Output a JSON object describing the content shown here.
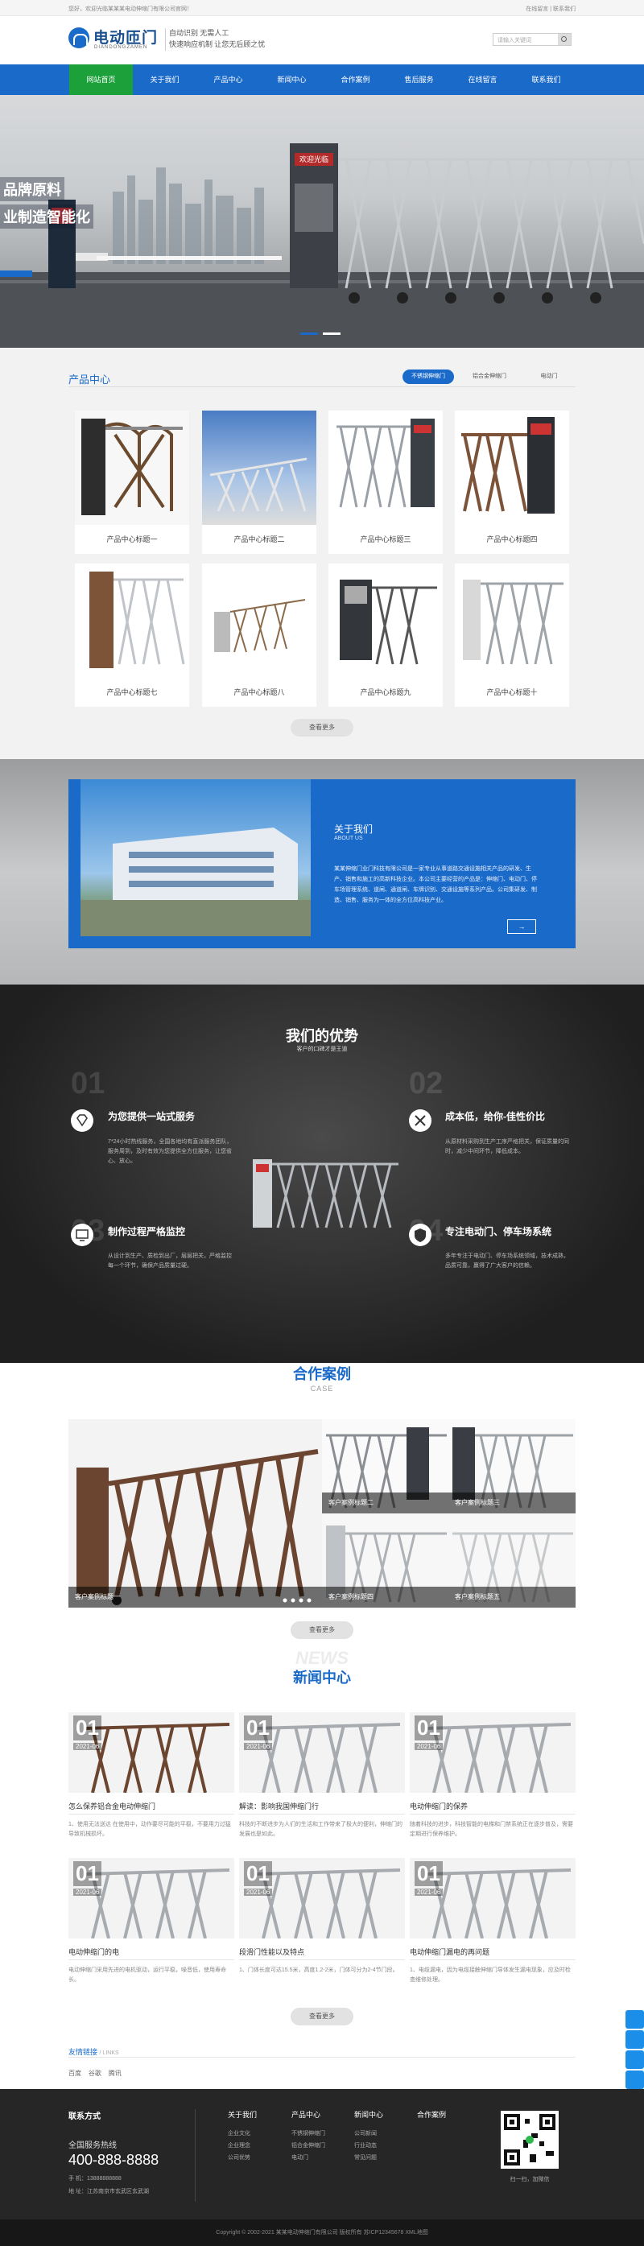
{
  "topbar": {
    "left": "您好，欢迎光临某某某电动伸缩门有限公司官网！",
    "right": "在线留言 | 联系我们"
  },
  "header": {
    "logo_text": "电动匝门",
    "logo_sub": "DIANDONGZAMEN",
    "slogan1": "自动识别 无需人工",
    "slogan2": "快速响应机制 让您无后顾之忧",
    "search_placeholder": "请输入关键词"
  },
  "nav": [
    "网站首页",
    "关于我们",
    "产品中心",
    "新闻中心",
    "合作案例",
    "售后服务",
    "在线留言",
    "联系我们"
  ],
  "banner": {
    "line1": "品牌原料",
    "line2": "业制造智能化",
    "sign": "欢迎光临"
  },
  "products": {
    "title": "产品中心",
    "tabs": [
      "不锈钢伸缩门",
      "铝合金伸缩门",
      "电动门"
    ],
    "items": [
      "产品中心标题一",
      "产品中心标题二",
      "产品中心标题三",
      "产品中心标题四",
      "产品中心标题七",
      "产品中心标题八",
      "产品中心标题九",
      "产品中心标题十"
    ],
    "more": "查看更多"
  },
  "about": {
    "title": "关于我们",
    "sub": "ABOUT US",
    "text": "某某伸缩门业门科技有限公司是一家专业从事道路交通设施相关产品的研发、生产、销售和施工的高新科技企业。本公司主要经营的产品是：伸缩门、电动门、停车场管理系统、道闸、通道闸、车牌识别、交通设施等系列产品。公司集研发、制造、销售、服务为一体的全方位高科技产业。",
    "arrow": "→"
  },
  "advantages": {
    "title": "我们的优势",
    "sub": "客户的口碑才是王道",
    "items": [
      {
        "num": "01",
        "title": "为您提供一站式服务",
        "text": "7*24小时热线服务，全国各地均有直派服务团队，服务周到，及时有效为您提供全方位服务，让您省心、放心。"
      },
      {
        "num": "02",
        "title": "成本低，给你-佳性价比",
        "text": "从原材料采购到生产工序严格把关，保证质量的同时，减少中间环节，降低成本。"
      },
      {
        "num": "03",
        "title": "制作过程严格监控",
        "text": "从设计到生产、质检到出厂，层层把关，严格监控每一个环节，确保产品质量过硬。"
      },
      {
        "num": "04",
        "title": "专注电动门、停车场系统",
        "text": "多年专注于电动门、停车场系统领域，技术成熟，品质可靠，赢得了广大客户的信赖。"
      }
    ]
  },
  "cases": {
    "title": "合作案例",
    "sub": "CASE",
    "captions": [
      "客户案例标题一",
      "客户案例标题二",
      "客户案例标题三",
      "客户案例标题四",
      "客户案例标题五"
    ],
    "more": "查看更多"
  },
  "news": {
    "ghost": "NEWS",
    "title": "新闻中心",
    "items": [
      {
        "day": "01",
        "ym": "2021-06",
        "title": "怎么保养铝合金电动伸缩门",
        "text": "1、使用无法送达 在使用中，动作要尽可能的平稳，不要用力过猛导致机械损坏。"
      },
      {
        "day": "01",
        "ym": "2021-06",
        "title": "解读：影响我国伸缩门行",
        "text": "科技的不断进步为人们的生活和工作带来了极大的便利，伸缩门的发展也是如此。"
      },
      {
        "day": "01",
        "ym": "2021-06",
        "title": "电动伸缩门的保养",
        "text": "随着科技的进步，科技智能的电梯和门禁系统正在逐步普及，需要定期进行保养维护。"
      },
      {
        "day": "01",
        "ym": "2021-06",
        "title": "电动伸缩门的电",
        "text": "电动伸缩门采用先进的电机驱动，运行平稳，噪音低，使用寿命长。"
      },
      {
        "day": "01",
        "ym": "2021-06",
        "title": "段滑门性能以及特点",
        "text": "1、门体长度可达15.5米，高度1.2-2米，门体可分为2-4节门段。"
      },
      {
        "day": "01",
        "ym": "2021-06",
        "title": "电动伸缩门漏电的再问题",
        "text": "1、电缆漏电，因为电缆接触伸缩门导体发生漏电现象，应及时检查维修处理。"
      }
    ],
    "more": "查看更多"
  },
  "links": {
    "title": "友情链接",
    "sub": "/ LINKS",
    "items": [
      "百度",
      "谷歌",
      "腾讯"
    ]
  },
  "footer": {
    "contact_title": "联系方式",
    "hotline_label": "全国服务热线",
    "hotline": "400-888-8888",
    "phone": "手  机：13888888888",
    "address": "地  址：江苏南京市玄武区玄武湖",
    "cols": [
      {
        "title": "关于我们",
        "items": [
          "企业文化",
          "企业理念",
          "公司优势"
        ]
      },
      {
        "title": "产品中心",
        "items": [
          "不锈钢伸缩门",
          "铝合金伸缩门",
          "电动门"
        ]
      },
      {
        "title": "新闻中心",
        "items": [
          "公司新闻",
          "行业动态",
          "常见问题"
        ]
      },
      {
        "title": "合作案例",
        "items": []
      }
    ],
    "qr_caption": "扫一扫，加微信"
  },
  "bottom": "Copyright © 2002-2021 某某电动伸缩门有限公司 版权所有  苏ICP12345678 XML地图",
  "colors": {
    "primary": "#1a6ac9",
    "nav_active": "#1ba03a",
    "footer": "#262626"
  }
}
